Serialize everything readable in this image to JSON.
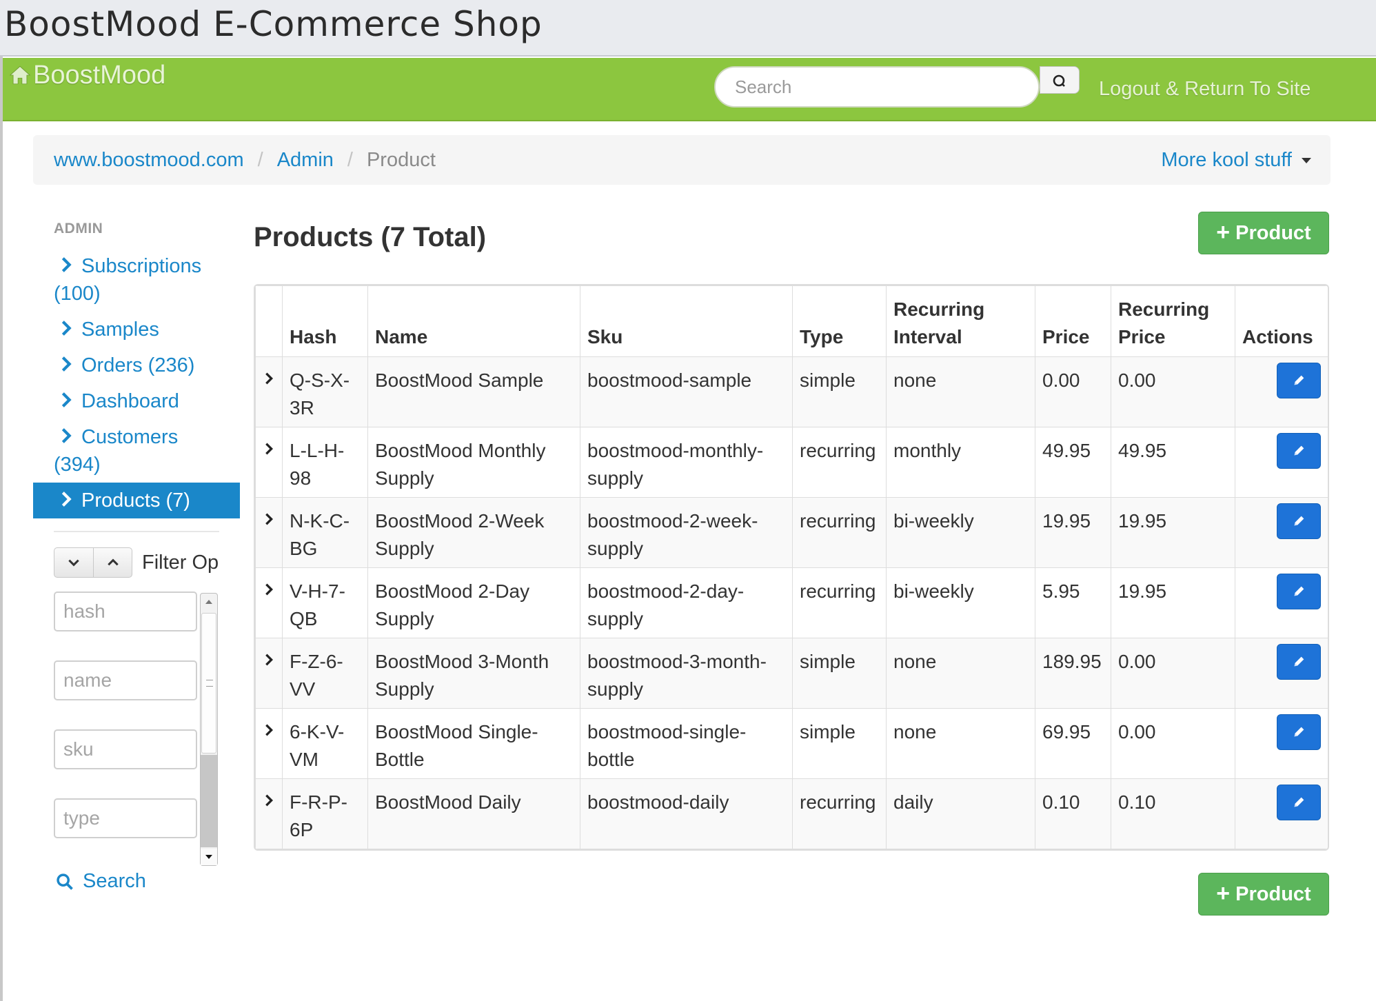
{
  "window": {
    "title": "BoostMood E-Commerce Shop"
  },
  "navbar": {
    "brand": "BoostMood",
    "brand_icon": "home-icon",
    "search_placeholder": "Search",
    "search_button_icon": "search-icon",
    "logout_label": "Logout & Return To Site",
    "background": "#8cc63f"
  },
  "breadcrumb": {
    "items": [
      "www.boostmood.com",
      "Admin",
      "Product"
    ],
    "dropdown_label": "More kool stuff"
  },
  "sidebar": {
    "heading": "ADMIN",
    "items": [
      {
        "label": "Subscriptions (100)",
        "active": false
      },
      {
        "label": "Samples",
        "active": false
      },
      {
        "label": "Orders (236)",
        "active": false
      },
      {
        "label": "Dashboard",
        "active": false
      },
      {
        "label": "Customers (394)",
        "active": false
      },
      {
        "label": "Products (7)",
        "active": true
      }
    ],
    "filter": {
      "label": "Filter Op",
      "fields": [
        {
          "placeholder": "hash"
        },
        {
          "placeholder": "name"
        },
        {
          "placeholder": "sku"
        },
        {
          "placeholder": "type"
        }
      ],
      "search_label": "Search"
    }
  },
  "main": {
    "title": "Products (7 Total)",
    "add_button_label": "Product",
    "table": {
      "columns": [
        "",
        "Hash",
        "Name",
        "Sku",
        "Type",
        "Recurring Interval",
        "Price",
        "Recurring Price",
        "Actions"
      ],
      "rows": [
        {
          "hash": "Q-S-X-3R",
          "name": "BoostMood Sample",
          "sku": "boostmood-sample",
          "type": "simple",
          "interval": "none",
          "price": "0.00",
          "recurring_price": "0.00"
        },
        {
          "hash": "L-L-H-98",
          "name": "BoostMood Monthly Supply",
          "sku": "boostmood-monthly-supply",
          "type": "recurring",
          "interval": "monthly",
          "price": "49.95",
          "recurring_price": "49.95"
        },
        {
          "hash": "N-K-C-BG",
          "name": "BoostMood 2-Week Supply",
          "sku": "boostmood-2-week-supply",
          "type": "recurring",
          "interval": "bi-weekly",
          "price": "19.95",
          "recurring_price": "19.95"
        },
        {
          "hash": "V-H-7-QB",
          "name": "BoostMood 2-Day Supply",
          "sku": "boostmood-2-day-supply",
          "type": "recurring",
          "interval": "bi-weekly",
          "price": "5.95",
          "recurring_price": "19.95"
        },
        {
          "hash": "F-Z-6-VV",
          "name": "BoostMood 3-Month Supply",
          "sku": "boostmood-3-month-supply",
          "type": "simple",
          "interval": "none",
          "price": "189.95",
          "recurring_price": "0.00"
        },
        {
          "hash": "6-K-V-VM",
          "name": "BoostMood Single-Bottle",
          "sku": "boostmood-single-bottle",
          "type": "simple",
          "interval": "none",
          "price": "69.95",
          "recurring_price": "0.00"
        },
        {
          "hash": "F-R-P-6P",
          "name": "BoostMood Daily",
          "sku": "boostmood-daily",
          "type": "recurring",
          "interval": "daily",
          "price": "0.10",
          "recurring_price": "0.10"
        }
      ],
      "row_action_icon": "pencil-icon"
    }
  },
  "colors": {
    "link": "#1a87c9",
    "active_nav": "#1a87c9",
    "success_button": "#5cb65c",
    "edit_button": "#1e73d8"
  }
}
